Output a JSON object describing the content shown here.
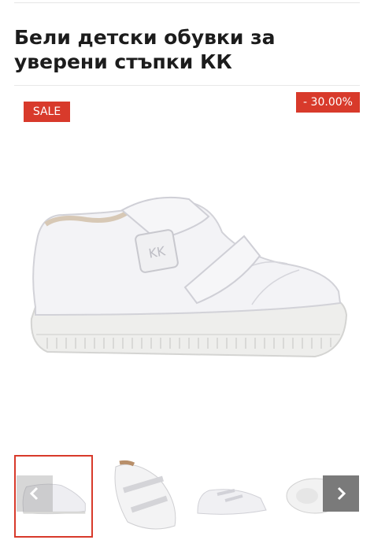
{
  "product": {
    "title": "Бели детски обувки за уверени стъпки КК"
  },
  "badges": {
    "sale": "SALE",
    "discount": "- 30.00%"
  },
  "gallery": {
    "main_image": "white-kids-sneaker-velcro",
    "thumbnails": [
      {
        "name": "side-view",
        "active": true
      },
      {
        "name": "top-view",
        "active": false
      },
      {
        "name": "pair-view",
        "active": false
      },
      {
        "name": "sole-view",
        "active": false
      }
    ],
    "prev_icon": "chevron-left-icon",
    "next_icon": "chevron-right-icon"
  },
  "colors": {
    "accent": "#d83a2b"
  }
}
